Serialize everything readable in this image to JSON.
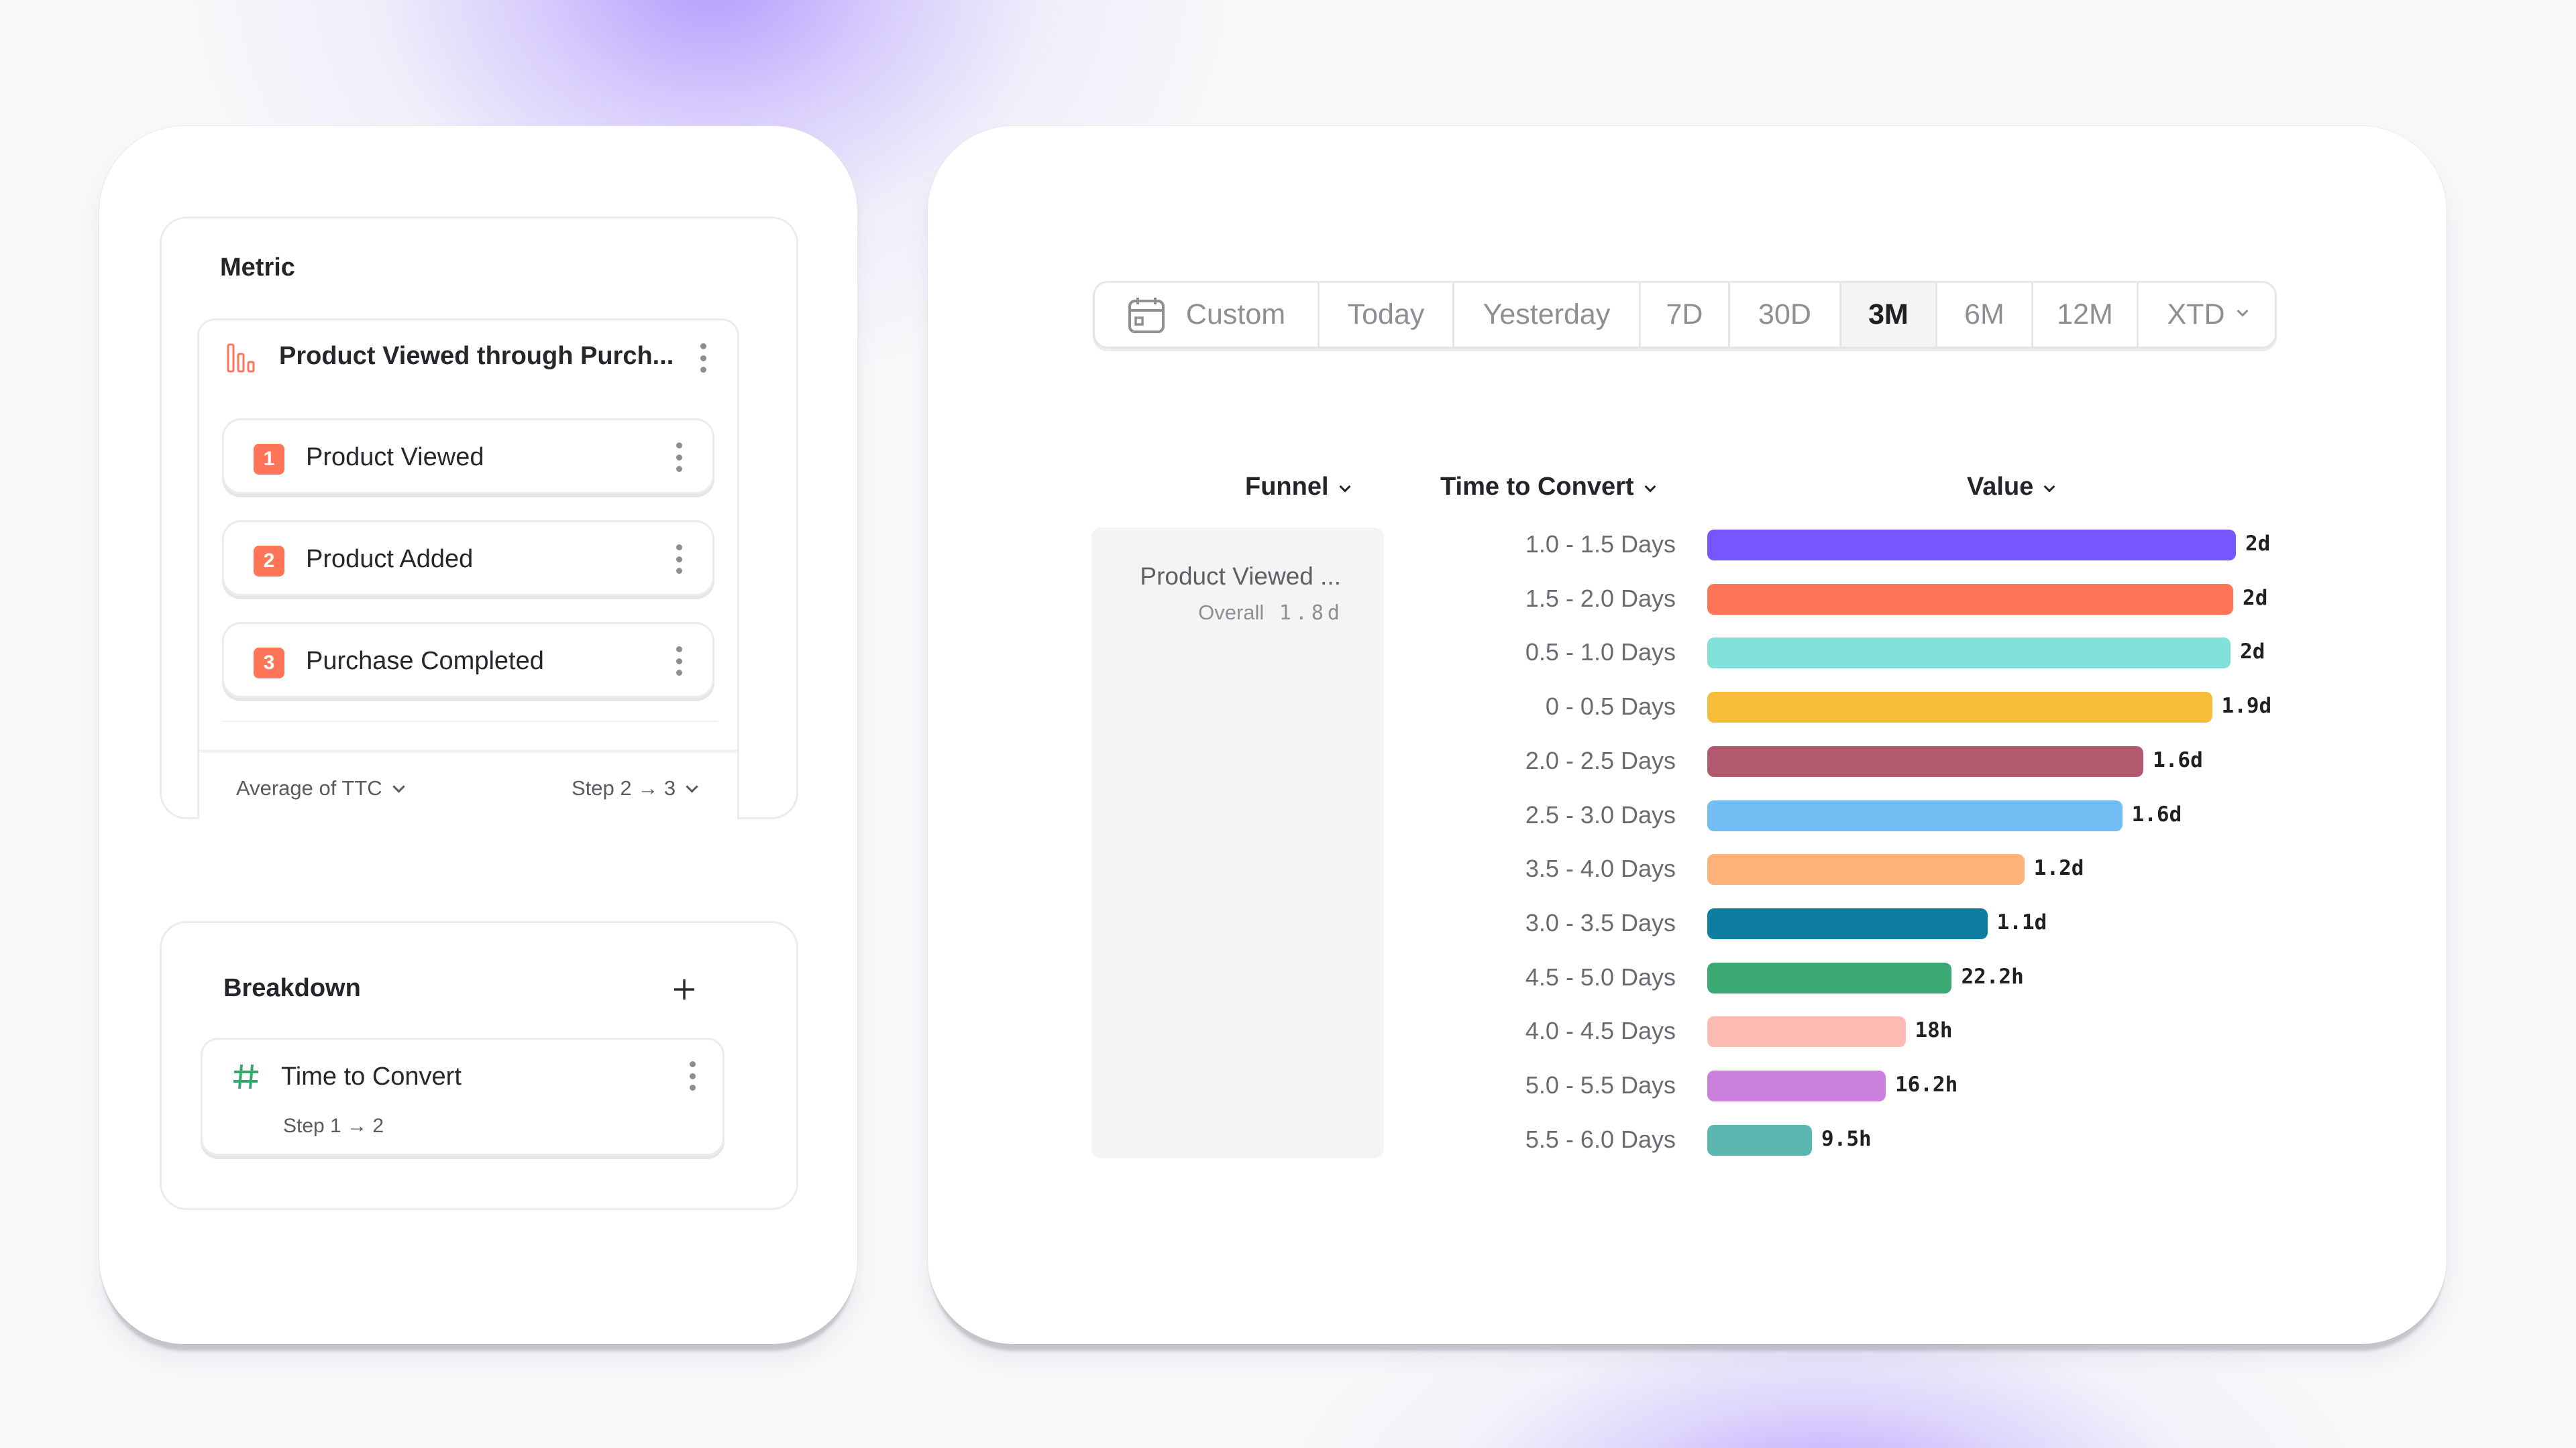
{
  "metric_panel": {
    "title": "Metric",
    "funnel_name": "Product Viewed through Purch...",
    "funnel_icon": "bar-chart-icon",
    "steps": [
      {
        "number": "1",
        "label": "Product Viewed"
      },
      {
        "number": "2",
        "label": "Product Added"
      },
      {
        "number": "3",
        "label": "Purchase Completed"
      }
    ],
    "aggregation": "Average of TTC",
    "step_range": "Step 2 → 3"
  },
  "breakdown_panel": {
    "title": "Breakdown",
    "add_icon": "plus-icon",
    "item": {
      "icon": "hash-icon",
      "label": "Time to Convert",
      "sublabel": "Step 1 → 2"
    }
  },
  "date_range": {
    "custom_label": "Custom",
    "tabs": [
      "Today",
      "Yesterday",
      "7D",
      "30D",
      "3M",
      "6M",
      "12M"
    ],
    "xtd_label": "XTD",
    "selected": "3M"
  },
  "table": {
    "headers": {
      "funnel": "Funnel",
      "breakdown": "Time to Convert",
      "value": "Value"
    },
    "funnel_cell": {
      "name": "Product Viewed ...",
      "overall_label": "Overall",
      "overall_value": "1.8d"
    }
  },
  "colors": {
    "accent_orange": "#ff7557",
    "hash_green": "#35a56e",
    "bars": [
      "#7856ff",
      "#ff7557",
      "#80e1d9",
      "#f8bc3b",
      "#b2596e",
      "#72bef4",
      "#ffb27a",
      "#0d7ea0",
      "#3ba974",
      "#febbb2",
      "#ca80dc",
      "#5bb7af"
    ]
  },
  "chart_data": {
    "type": "bar",
    "orientation": "horizontal",
    "title": "",
    "xlabel": "Value",
    "ylabel": "Time to Convert",
    "unit": "days",
    "xlim": [
      0,
      2.0
    ],
    "grid": false,
    "categories": [
      "1.0 - 1.5 Days",
      "1.5 - 2.0 Days",
      "0.5 - 1.0 Days",
      "0 - 0.5 Days",
      "2.0 - 2.5 Days",
      "2.5 - 3.0 Days",
      "3.5 - 4.0 Days",
      "3.0 - 3.5 Days",
      "4.5 - 5.0 Days",
      "4.0 - 4.5 Days",
      "5.0 - 5.5 Days",
      "5.5 - 6.0 Days"
    ],
    "values": [
      2.0,
      1.99,
      1.98,
      1.91,
      1.65,
      1.57,
      1.2,
      1.06,
      0.925,
      0.75,
      0.675,
      0.396
    ],
    "labels": [
      "2d",
      "2d",
      "2d",
      "1.9d",
      "1.6d",
      "1.6d",
      "1.2d",
      "1.1d",
      "22.2h",
      "18h",
      "16.2h",
      "9.5h"
    ]
  }
}
